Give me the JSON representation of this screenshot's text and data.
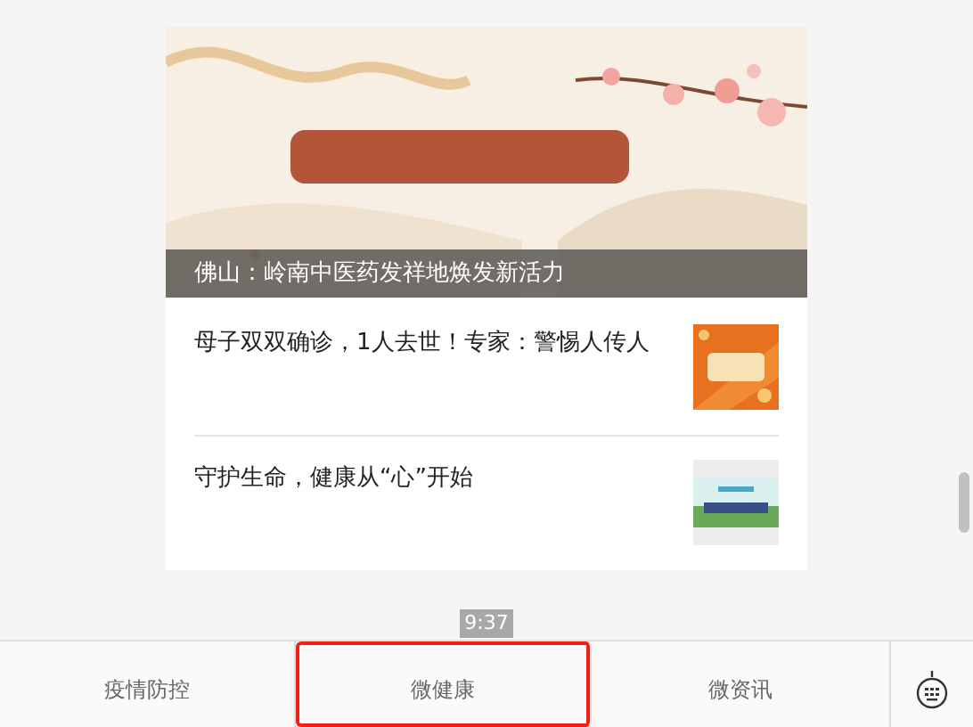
{
  "feed": {
    "headline": {
      "kind": "picture",
      "caption": "佛山：岭南中医药发祥地焕发新活力"
    },
    "articles": [
      {
        "title": "母子双双确诊，1人去世！专家：警惕人传人"
      },
      {
        "title": "守护生命，健康从“心”开始"
      }
    ]
  },
  "timestamp": "9:37",
  "menu_bar": {
    "items": [
      {
        "label": "疫情防控",
        "highlighted": false
      },
      {
        "label": "微健康",
        "highlighted": true
      },
      {
        "label": "微资讯",
        "highlighted": false
      }
    ]
  }
}
